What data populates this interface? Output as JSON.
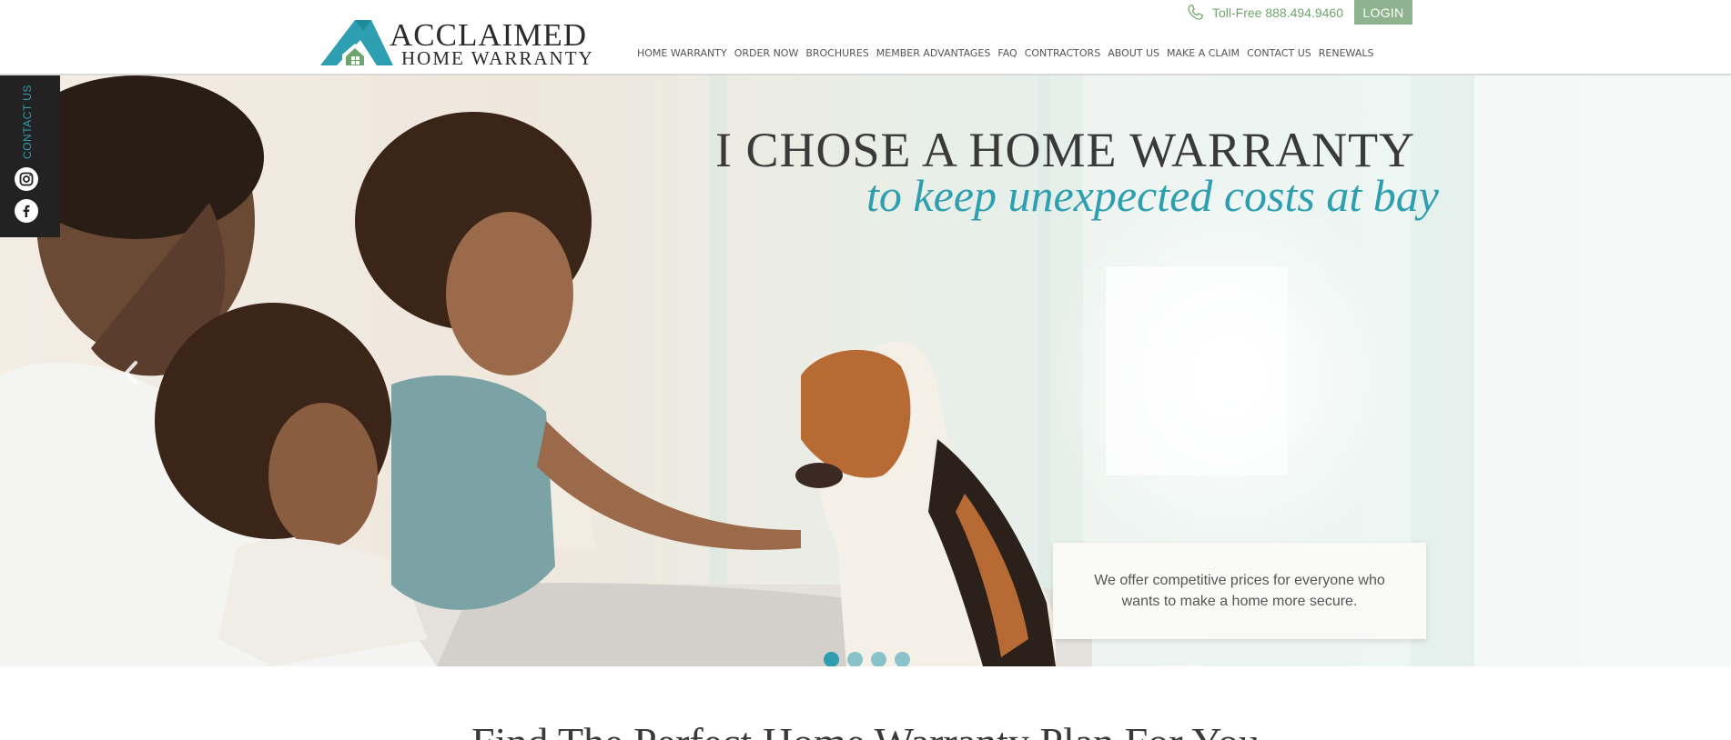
{
  "brand": {
    "name_line1": "ACCLAIMED",
    "name_line2": "HOME WARRANTY",
    "accent_color": "#2e9fb0",
    "logo_house_color": "#6fa56f"
  },
  "topbar": {
    "phone_icon": "phone-icon",
    "phone_text": "Toll-Free 888.494.9460",
    "login_label": "LOGIN"
  },
  "nav": {
    "items": [
      {
        "label": "HOME WARRANTY"
      },
      {
        "label": "ORDER NOW"
      },
      {
        "label": "BROCHURES"
      },
      {
        "label": "MEMBER ADVANTAGES"
      },
      {
        "label": "FAQ"
      },
      {
        "label": "CONTRACTORS"
      },
      {
        "label": "ABOUT US"
      },
      {
        "label": "MAKE A CLAIM"
      },
      {
        "label": "CONTACT US"
      },
      {
        "label": "RENEWALS"
      }
    ]
  },
  "sidebar": {
    "contact_label": "CONTACT US",
    "icons": [
      "instagram-icon",
      "facebook-icon"
    ]
  },
  "hero": {
    "title": "I CHOSE A HOME WARRANTY",
    "subtitle": "to keep unexpected costs at bay",
    "caption": "We offer competitive prices for everyone who wants to make a home more secure.",
    "prev_icon": "chevron-left-icon",
    "slide_count": 4,
    "active_slide": 1
  },
  "section": {
    "heading": "Find The Perfect Home Warranty Plan For You"
  }
}
